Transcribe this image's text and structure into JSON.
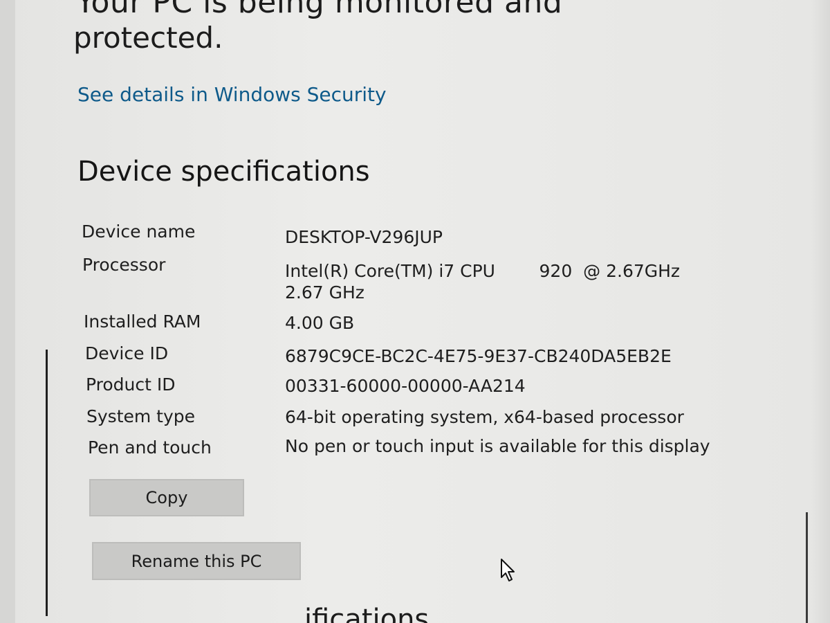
{
  "status": {
    "line1": "Your PC is being monitored and",
    "line2": "protected."
  },
  "security_link": "See details in Windows Security",
  "device_specifications": {
    "title": "Device specifications",
    "rows": [
      {
        "label": "Device name",
        "value": "DESKTOP-V296JUP",
        "value2": ""
      },
      {
        "label": "Processor",
        "value": "Intel(R) Core(TM) i7 CPU        920  @ 2.67GHz",
        "value2": "2.67 GHz"
      },
      {
        "label": "Installed RAM",
        "value": "4.00 GB",
        "value2": ""
      },
      {
        "label": "Device ID",
        "value": "6879C9CE-BC2C-4E75-9E37-CB240DA5EB2E",
        "value2": ""
      },
      {
        "label": "Product ID",
        "value": "00331-60000-00000-AA214",
        "value2": ""
      },
      {
        "label": "System type",
        "value": "64-bit operating system, x64-based processor",
        "value2": ""
      },
      {
        "label": "Pen and touch",
        "value": "No pen or touch input is available for this display",
        "value2": ""
      }
    ],
    "copy_label": "Copy",
    "rename_label": "Rename this PC"
  },
  "next_section_partial": "ifications",
  "icons": {
    "cursor": "mouse-pointer-icon"
  }
}
